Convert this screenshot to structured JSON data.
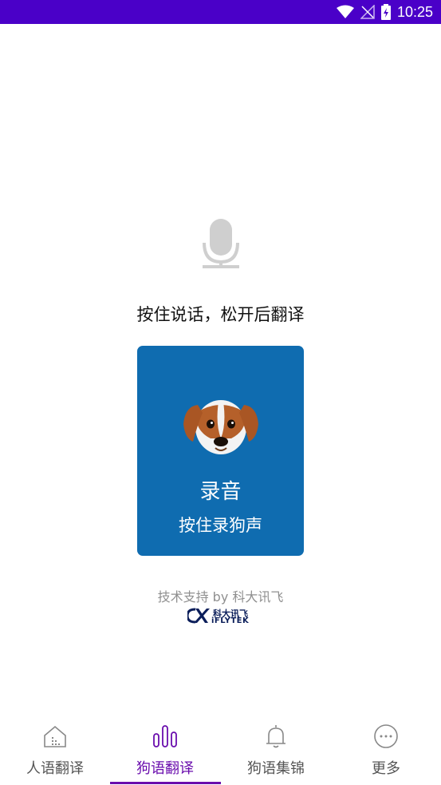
{
  "status_bar": {
    "time": "10:25",
    "icons": [
      "wifi-icon",
      "no-signal-icon",
      "battery-charging-icon"
    ],
    "background": "#4a00c8"
  },
  "main": {
    "mic_icon": "microphone-icon",
    "prompt": "按住说话，松开后翻译",
    "record_card": {
      "title": "录音",
      "subtitle": "按住录狗声",
      "image": "dog-face-icon",
      "background": "#0f6cb0"
    },
    "credit": "技术支持 by 科大讯飞",
    "brand": {
      "cn": "科大讯飞",
      "en": "iFLYTEK"
    }
  },
  "tabs": [
    {
      "label": "人语翻译",
      "icon": "home-icon",
      "active": false
    },
    {
      "label": "狗语翻译",
      "icon": "sound-bars-icon",
      "active": true
    },
    {
      "label": "狗语集锦",
      "icon": "bell-icon",
      "active": false
    },
    {
      "label": "更多",
      "icon": "more-dots-icon",
      "active": false
    }
  ],
  "colors": {
    "accent": "#6a0dad",
    "inactive": "#555555"
  }
}
